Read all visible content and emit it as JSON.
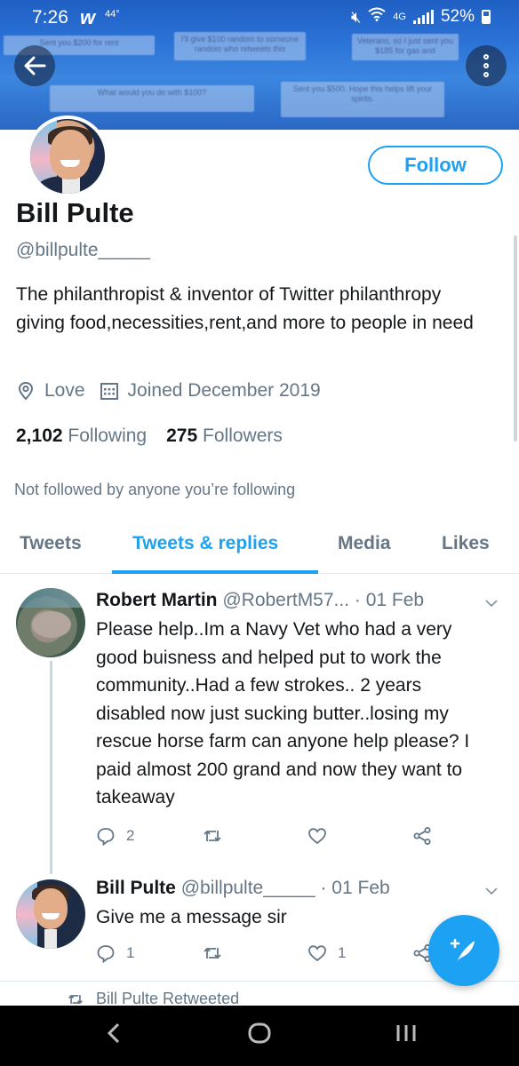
{
  "status": {
    "time": "7:26",
    "temperature": "44°",
    "network": "4G",
    "battery": "52%"
  },
  "banner": {
    "cards": [
      "Sent you $200 for rent",
      "I'll give $100 random to someone random who retweets this",
      "Veterans, so I just sent you $185 for gas and",
      "What would you do with $100?",
      "Sent you $500. Hope this helps lift your spirits."
    ]
  },
  "profile": {
    "name": "Bill Pulte",
    "handle": "@billpulte_____",
    "follow_label": "Follow",
    "bio": "The philanthropist & inventor of Twitter philanthropy giving food,necessities,rent,and more to people in need",
    "location": "Love",
    "joined": "Joined December 2019",
    "following_count": "2,102",
    "following_label": "Following",
    "followers_count": "275",
    "followers_label": "Followers",
    "not_followed": "Not followed by anyone you’re following"
  },
  "tabs": [
    {
      "label": "Tweets"
    },
    {
      "label": "Tweets & replies",
      "active": true
    },
    {
      "label": "Media"
    },
    {
      "label": "Likes"
    }
  ],
  "tweets": [
    {
      "name": "Robert Martin",
      "handle": "@RobertM57...",
      "date": "· 01 Feb",
      "text": "Please help..Im a Navy Vet who had a very good buisness and helped put to work the community..Had a few strokes.. 2 years disabled now just sucking butter..losing my rescue horse farm can anyone help please? I paid almost 200 grand and now they want to takeaway",
      "replies": "2",
      "retweets": "",
      "likes": ""
    },
    {
      "name": "Bill Pulte",
      "handle": "@billpulte_____",
      "date": "· 01 Feb",
      "text": "Give me a message sir",
      "replies": "1",
      "retweets": "",
      "likes": "1"
    }
  ],
  "retweeted_label": "Bill Pulte Retweeted",
  "colors": {
    "accent": "#1da1f2",
    "secondary_text": "#657786",
    "primary_text": "#14171a"
  }
}
